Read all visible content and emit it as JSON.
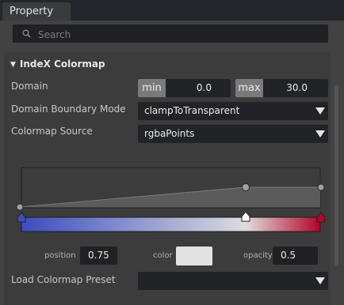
{
  "tab": {
    "title": "Property"
  },
  "search": {
    "placeholder": "Search"
  },
  "section": {
    "title": "IndeX Colormap"
  },
  "domain": {
    "label": "Domain",
    "min_tag": "min",
    "min_value": "0.0",
    "max_tag": "max",
    "max_value": "30.0"
  },
  "boundary_mode": {
    "label": "Domain Boundary Mode",
    "value": "clampToTransparent"
  },
  "colormap_source": {
    "label": "Colormap Source",
    "value": "rgbaPoints"
  },
  "gradient": {
    "stops": [
      "#3b4cc0",
      "#dddddd",
      "#b40426"
    ],
    "point_color": "#e2e2e2"
  },
  "point_editor": {
    "position_label": "position",
    "position_value": "0.75",
    "color_label": "color",
    "opacity_label": "opacity",
    "opacity_value": "0.5"
  },
  "preset": {
    "label": "Load Colormap Preset",
    "value": ""
  },
  "icons": {
    "search": "search-icon",
    "collapse": "triangle-down-icon",
    "dropdown": "dropdown-arrow-icon"
  }
}
